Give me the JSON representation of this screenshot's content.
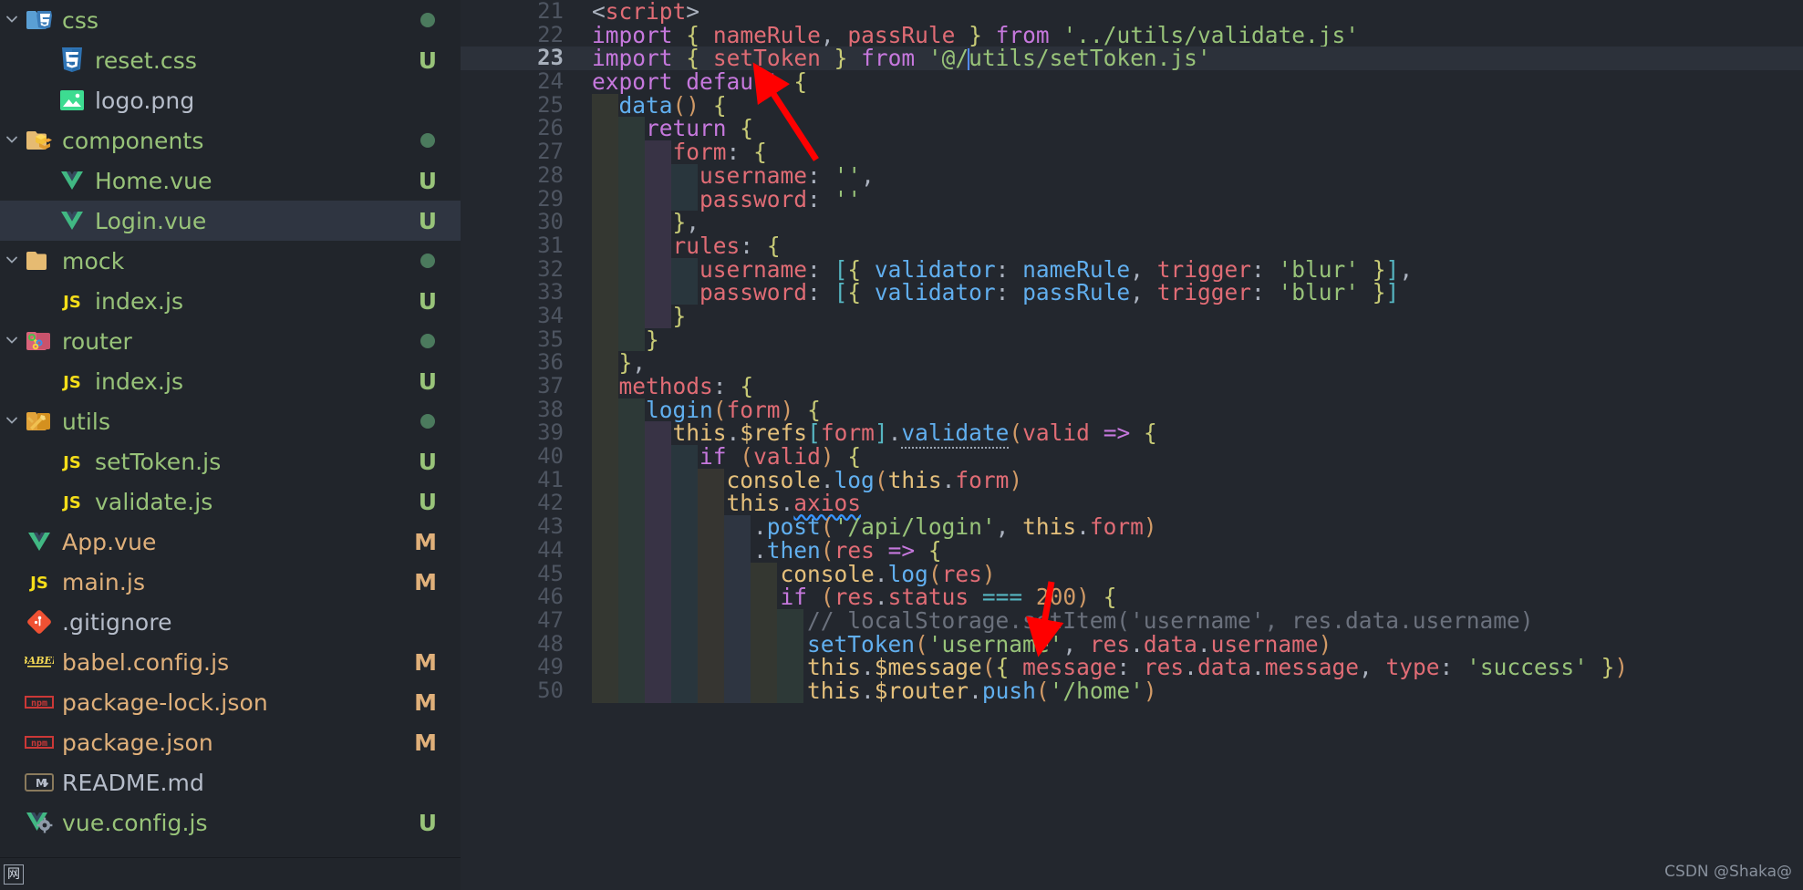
{
  "explorer": {
    "items": [
      {
        "name": "css",
        "kind": "folder",
        "icon": "folder-css-icon",
        "indent": 0,
        "twisty": "chevron-down",
        "status": "",
        "dot": true,
        "color": "#98c379",
        "selected": false
      },
      {
        "name": "reset.css",
        "kind": "file",
        "icon": "css3-file-icon",
        "indent": 1,
        "twisty": "",
        "status": "U",
        "dot": false,
        "color": "#98c379",
        "selected": false
      },
      {
        "name": "logo.png",
        "kind": "file",
        "icon": "image-file-icon",
        "indent": 1,
        "twisty": "",
        "status": "",
        "dot": false,
        "color": "#b6bdca",
        "selected": false
      },
      {
        "name": "components",
        "kind": "folder",
        "icon": "folder-components-icon",
        "indent": 0,
        "twisty": "chevron-down",
        "status": "",
        "dot": true,
        "color": "#98c379",
        "selected": false
      },
      {
        "name": "Home.vue",
        "kind": "file",
        "icon": "vue-file-icon",
        "indent": 1,
        "twisty": "",
        "status": "U",
        "dot": false,
        "color": "#98c379",
        "selected": false
      },
      {
        "name": "Login.vue",
        "kind": "file",
        "icon": "vue-file-icon",
        "indent": 1,
        "twisty": "",
        "status": "U",
        "dot": false,
        "color": "#98c379",
        "selected": true
      },
      {
        "name": "mock",
        "kind": "folder",
        "icon": "folder-plain-icon",
        "indent": 0,
        "twisty": "chevron-down",
        "status": "",
        "dot": true,
        "color": "#98c379",
        "selected": false
      },
      {
        "name": "index.js",
        "kind": "file",
        "icon": "js-file-icon",
        "indent": 1,
        "twisty": "",
        "status": "U",
        "dot": false,
        "color": "#98c379",
        "selected": false
      },
      {
        "name": "router",
        "kind": "folder",
        "icon": "folder-router-icon",
        "indent": 0,
        "twisty": "chevron-down",
        "status": "",
        "dot": true,
        "color": "#98c379",
        "selected": false
      },
      {
        "name": "index.js",
        "kind": "file",
        "icon": "js-file-icon",
        "indent": 1,
        "twisty": "",
        "status": "U",
        "dot": false,
        "color": "#98c379",
        "selected": false
      },
      {
        "name": "utils",
        "kind": "folder",
        "icon": "folder-utils-icon",
        "indent": 0,
        "twisty": "chevron-down",
        "status": "",
        "dot": true,
        "color": "#98c379",
        "selected": false
      },
      {
        "name": "setToken.js",
        "kind": "file",
        "icon": "js-file-icon",
        "indent": 1,
        "twisty": "",
        "status": "U",
        "dot": false,
        "color": "#98c379",
        "selected": false
      },
      {
        "name": "validate.js",
        "kind": "file",
        "icon": "js-file-icon",
        "indent": 1,
        "twisty": "",
        "status": "U",
        "dot": false,
        "color": "#98c379",
        "selected": false
      },
      {
        "name": "App.vue",
        "kind": "file",
        "icon": "vue-file-icon",
        "indent": 0,
        "twisty": "",
        "status": "M",
        "dot": false,
        "color": "#e0b07a",
        "selected": false
      },
      {
        "name": "main.js",
        "kind": "file",
        "icon": "js-file-icon",
        "indent": 0,
        "twisty": "",
        "status": "M",
        "dot": false,
        "color": "#e0b07a",
        "selected": false
      },
      {
        "name": ".gitignore",
        "kind": "file",
        "icon": "git-file-icon",
        "indent": 0,
        "twisty": "",
        "status": "",
        "dot": false,
        "color": "#b6bdca",
        "selected": false
      },
      {
        "name": "babel.config.js",
        "kind": "file",
        "icon": "babel-file-icon",
        "indent": 0,
        "twisty": "",
        "status": "M",
        "dot": false,
        "color": "#e0b07a",
        "selected": false
      },
      {
        "name": "package-lock.json",
        "kind": "file",
        "icon": "npm-file-icon",
        "indent": 0,
        "twisty": "",
        "status": "M",
        "dot": false,
        "color": "#e0b07a",
        "selected": false
      },
      {
        "name": "package.json",
        "kind": "file",
        "icon": "npm-file-icon",
        "indent": 0,
        "twisty": "",
        "status": "M",
        "dot": false,
        "color": "#e0b07a",
        "selected": false
      },
      {
        "name": "README.md",
        "kind": "file",
        "icon": "markdown-file-icon",
        "indent": 0,
        "twisty": "",
        "status": "",
        "dot": false,
        "color": "#b6bdca",
        "selected": false
      },
      {
        "name": "vue.config.js",
        "kind": "file",
        "icon": "vue-config-file-icon",
        "indent": 0,
        "twisty": "",
        "status": "U",
        "dot": false,
        "color": "#98c379",
        "selected": false
      }
    ]
  },
  "editor": {
    "active_line": 23,
    "first_line": 21,
    "lines": [
      {
        "n": "21",
        "text": "<script>"
      },
      {
        "n": "22",
        "text": "import { nameRule, passRule } from '../utils/validate.js'"
      },
      {
        "n": "23",
        "text": "import { setToken } from '@/utils/setToken.js'"
      },
      {
        "n": "24",
        "text": "export default {"
      },
      {
        "n": "25",
        "text": "  data() {"
      },
      {
        "n": "26",
        "text": "    return {"
      },
      {
        "n": "27",
        "text": "      form: {"
      },
      {
        "n": "28",
        "text": "        username: '',"
      },
      {
        "n": "29",
        "text": "        password: ''"
      },
      {
        "n": "30",
        "text": "      },"
      },
      {
        "n": "31",
        "text": "      rules: {"
      },
      {
        "n": "32",
        "text": "        username: [{ validator: nameRule, trigger: 'blur' }],"
      },
      {
        "n": "33",
        "text": "        password: [{ validator: passRule, trigger: 'blur' }]"
      },
      {
        "n": "34",
        "text": "      }"
      },
      {
        "n": "35",
        "text": "    }"
      },
      {
        "n": "36",
        "text": "  },"
      },
      {
        "n": "37",
        "text": "  methods: {"
      },
      {
        "n": "38",
        "text": "    login(form) {"
      },
      {
        "n": "39",
        "text": "      this.$refs[form].validate(valid => {"
      },
      {
        "n": "40",
        "text": "        if (valid) {"
      },
      {
        "n": "41",
        "text": "          console.log(this.form)"
      },
      {
        "n": "42",
        "text": "          this.axios"
      },
      {
        "n": "43",
        "text": "            .post('/api/login', this.form)"
      },
      {
        "n": "44",
        "text": "            .then(res => {"
      },
      {
        "n": "45",
        "text": "              console.log(res)"
      },
      {
        "n": "46",
        "text": "              if (res.status === 200) {"
      },
      {
        "n": "47",
        "text": "                // localStorage.setItem('username', res.data.username)"
      },
      {
        "n": "48",
        "text": "                setToken('username', res.data.username)"
      },
      {
        "n": "49",
        "text": "                this.$message({ message: res.data.message, type: 'success' })"
      },
      {
        "n": "50",
        "text": "                this.$router.push('/home')"
      }
    ]
  },
  "annotations": {
    "arrow_one_label": "arrow pointing to import setToken line",
    "arrow_two_label": "arrow pointing to setToken call line",
    "arrow_color": "#ff0000"
  },
  "watermark": {
    "text": "CSDN @Shaka@"
  },
  "statusbar": {
    "icon": "cjk-ime-icon",
    "icon_text": "网"
  }
}
